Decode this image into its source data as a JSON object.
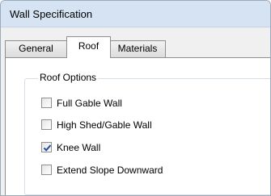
{
  "window": {
    "title": "Wall Specification"
  },
  "tabs": [
    {
      "label": "General",
      "selected": false
    },
    {
      "label": "Roof",
      "selected": true
    },
    {
      "label": "Materials",
      "selected": false
    }
  ],
  "roof_options": {
    "legend": "Roof Options",
    "checkboxes": [
      {
        "label": "Full Gable Wall",
        "checked": false
      },
      {
        "label": "High Shed/Gable Wall",
        "checked": false
      },
      {
        "label": "Knee Wall",
        "checked": true
      },
      {
        "label": "Extend Slope Downward",
        "checked": false
      }
    ]
  },
  "colors": {
    "check_mark": "#1c4f9c",
    "title_bar": "#d6e3f2",
    "dialog_bg": "#f0f0f0"
  }
}
